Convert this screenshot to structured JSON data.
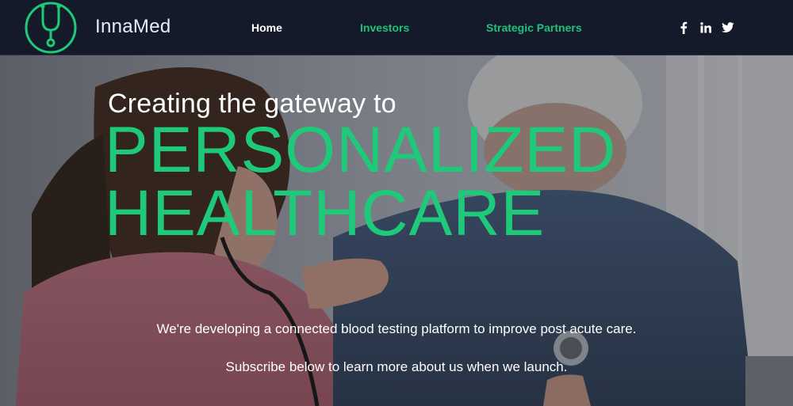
{
  "brand": {
    "name": "InnaMed"
  },
  "nav": {
    "home": "Home",
    "investors": "Investors",
    "partners": "Strategic Partners"
  },
  "social": {
    "facebook": "f",
    "linkedin": "in",
    "twitter_icon": "twitter-icon"
  },
  "hero": {
    "pre_title": "Creating the gateway to",
    "title_line1": "PERSONALIZED",
    "title_line2": "HEALTHCARE",
    "description": "We're developing a connected blood testing platform to improve post acute care.",
    "subscribe_text": "Subscribe below to learn more about us when we launch."
  },
  "colors": {
    "header_bg": "#151a2b",
    "accent": "#1fc97a",
    "text": "#ffffff"
  }
}
